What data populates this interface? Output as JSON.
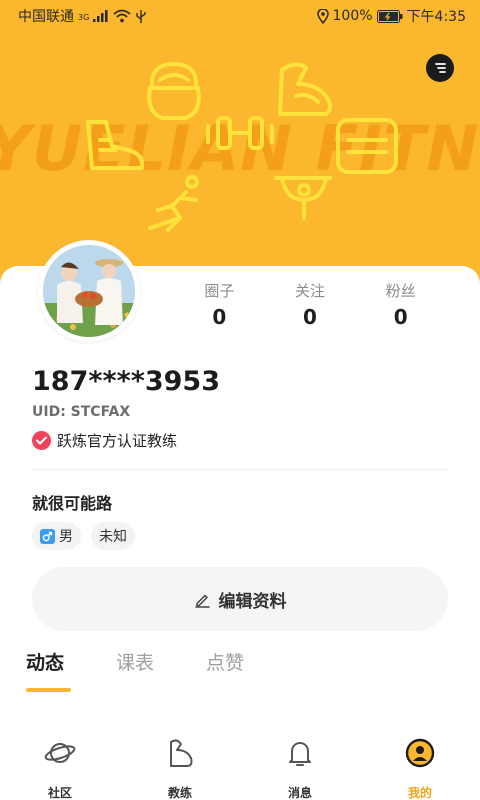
{
  "status_bar": {
    "carrier": "中国联通",
    "network": "3G",
    "battery": "100%",
    "time": "下午4:35"
  },
  "header": {
    "brand_text": "YUELIAN FITNESS",
    "menu_icon": "menu-icon",
    "accent_color": "#fbb72e"
  },
  "profile": {
    "avatar_icon": "avatar",
    "stats": [
      {
        "label": "圈子",
        "value": "0"
      },
      {
        "label": "关注",
        "value": "0"
      },
      {
        "label": "粉丝",
        "value": "0"
      }
    ],
    "username": "187****3953",
    "uid": "UID: STCFAX",
    "certification": "跃炼官方认证教练",
    "bio": "就很可能路",
    "tags": [
      {
        "label": "男",
        "icon": "male-icon"
      },
      {
        "label": "未知"
      }
    ],
    "edit_button": "编辑资料"
  },
  "tabs": [
    {
      "label": "动态",
      "active": true
    },
    {
      "label": "课表",
      "active": false
    },
    {
      "label": "点赞",
      "active": false
    }
  ],
  "bottom_nav": [
    {
      "label": "社区",
      "icon": "planet-icon",
      "active": false
    },
    {
      "label": "教练",
      "icon": "arm-icon",
      "active": false
    },
    {
      "label": "消息",
      "icon": "bell-icon",
      "active": false
    },
    {
      "label": "我的",
      "icon": "user-icon",
      "active": true
    }
  ]
}
